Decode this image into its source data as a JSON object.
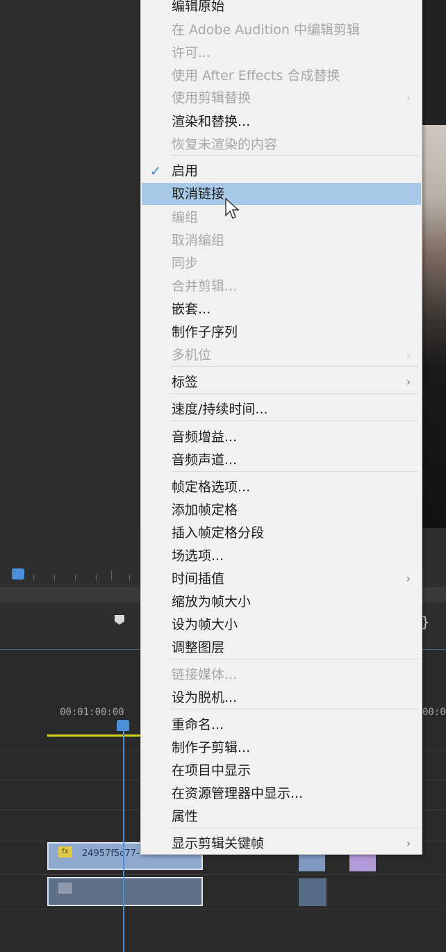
{
  "timeline": {
    "timecode_left": "00:01:00:00",
    "timecode_right": "00:0",
    "clip_name": "24957f5c77-",
    "accent_color": "#4a8fd8",
    "inout_color": "#d7d21f"
  },
  "context_menu": {
    "items": [
      {
        "label": "编辑原始",
        "enabled": true
      },
      {
        "label": "在 Adobe Audition 中编辑剪辑",
        "enabled": false
      },
      {
        "label": "许可...",
        "enabled": false
      },
      {
        "label": "使用 After Effects 合成替换",
        "enabled": false
      },
      {
        "label": "使用剪辑替换",
        "enabled": false,
        "submenu": true
      },
      {
        "label": "渲染和替换...",
        "enabled": true
      },
      {
        "label": "恢复未渲染的内容",
        "enabled": false
      },
      {
        "label": "启用",
        "enabled": true,
        "checked": true
      },
      {
        "label": "取消链接",
        "enabled": true,
        "highlighted": true
      },
      {
        "label": "编组",
        "enabled": false
      },
      {
        "label": "取消编组",
        "enabled": false
      },
      {
        "label": "同步",
        "enabled": false
      },
      {
        "label": "合并剪辑...",
        "enabled": false
      },
      {
        "label": "嵌套...",
        "enabled": true
      },
      {
        "label": "制作子序列",
        "enabled": true
      },
      {
        "label": "多机位",
        "enabled": false,
        "submenu": true
      },
      {
        "label": "标签",
        "enabled": true,
        "submenu": true
      },
      {
        "label": "速度/持续时间...",
        "enabled": true
      },
      {
        "label": "音频增益...",
        "enabled": true
      },
      {
        "label": "音频声道...",
        "enabled": true
      },
      {
        "label": "帧定格选项...",
        "enabled": true
      },
      {
        "label": "添加帧定格",
        "enabled": true
      },
      {
        "label": "插入帧定格分段",
        "enabled": true
      },
      {
        "label": "场选项...",
        "enabled": true
      },
      {
        "label": "时间插值",
        "enabled": true,
        "submenu": true
      },
      {
        "label": "缩放为帧大小",
        "enabled": true
      },
      {
        "label": "设为帧大小",
        "enabled": true
      },
      {
        "label": "调整图层",
        "enabled": true
      },
      {
        "label": "链接媒体...",
        "enabled": false
      },
      {
        "label": "设为脱机...",
        "enabled": true
      },
      {
        "label": "重命名...",
        "enabled": true
      },
      {
        "label": "制作子剪辑...",
        "enabled": true
      },
      {
        "label": "在项目中显示",
        "enabled": true
      },
      {
        "label": "在资源管理器中显示...",
        "enabled": true
      },
      {
        "label": "属性",
        "enabled": true
      },
      {
        "label": "显示剪辑关键帧",
        "enabled": true,
        "submenu": true
      }
    ],
    "submenu_glyph": "›",
    "check_glyph": "✓"
  }
}
